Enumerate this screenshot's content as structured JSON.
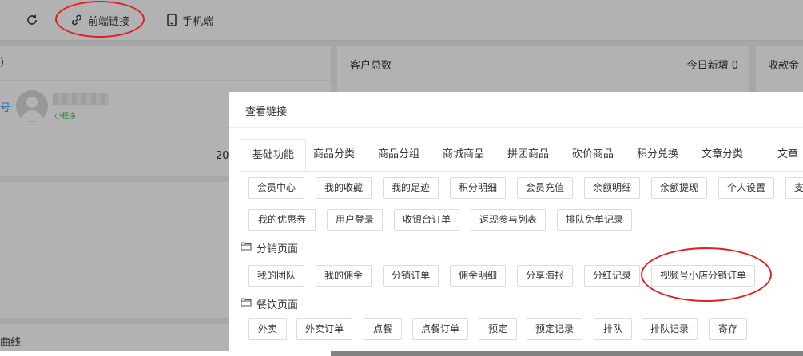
{
  "topbar": {
    "refresh_icon": "refresh-icon",
    "link_icon": "link-icon",
    "frontend_link_label": "前端链接",
    "mobile_icon": "mobile-icon",
    "mobile_label": "手机端"
  },
  "background": {
    "card1_title": ")",
    "card1_account_fragment": "号",
    "card1_miniprogram_label": "小程序",
    "card1_date_fragment": "20",
    "card2_title": "客户总数",
    "card2_today_new": "今日新增 0",
    "card3_title": "收款金",
    "bottom_label": "曲线"
  },
  "modal": {
    "title": "查看链接",
    "tabs": [
      "基础功能",
      "商品分类",
      "商品分组",
      "商城商品",
      "拼团商品",
      "砍价商品",
      "积分兑换",
      "文章分类",
      "文章"
    ],
    "basic_row1": [
      "会员中心",
      "我的收藏",
      "我的足迹",
      "积分明细",
      "会员充值",
      "余额明细",
      "余额提现",
      "个人设置",
      "支"
    ],
    "basic_row2": [
      "我的优惠券",
      "用户登录",
      "收银台订单",
      "返现参与列表",
      "排队免单记录"
    ],
    "distribution_section": "分销页面",
    "distribution_items": [
      "我的团队",
      "我的佣金",
      "分销订单",
      "佣金明细",
      "分享海报",
      "分红记录",
      "视频号小店分销订单"
    ],
    "catering_section": "餐饮页面",
    "catering_items": [
      "外卖",
      "外卖订单",
      "点餐",
      "点餐订单",
      "预定",
      "预定记录",
      "排队",
      "排队记录",
      "寄存"
    ]
  }
}
